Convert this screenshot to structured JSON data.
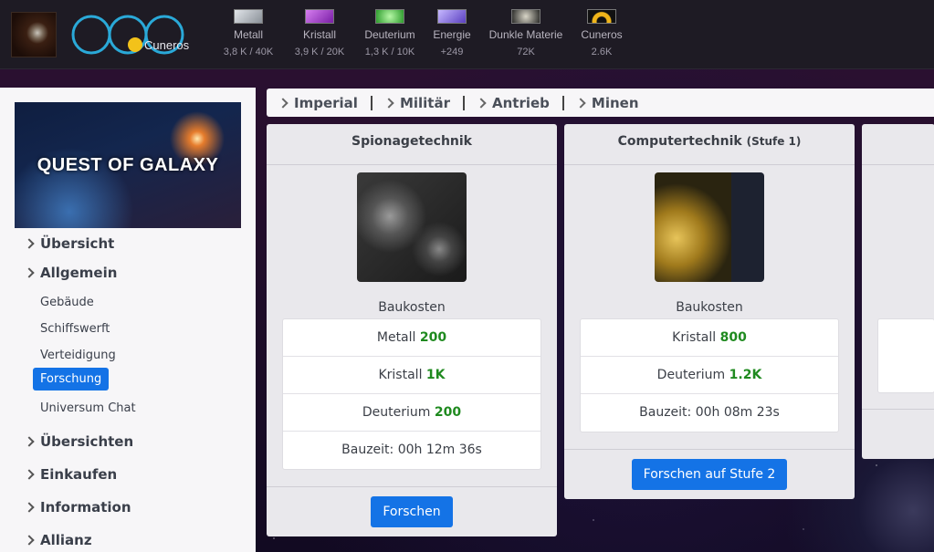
{
  "resources": [
    {
      "name": "Metall",
      "value": "3,8 K / 40K",
      "icon": "metal-icon",
      "color": "#b8bec6"
    },
    {
      "name": "Kristall",
      "value": "3,9 K / 20K",
      "icon": "crystal-icon",
      "color": "#b44ad8"
    },
    {
      "name": "Deuterium",
      "value": "1,3 K / 10K",
      "icon": "deuterium-icon",
      "color": "#3ecf3e"
    },
    {
      "name": "Energie",
      "value": "+249",
      "icon": "energy-icon",
      "color": "#7e62d6"
    },
    {
      "name": "Dunkle Materie",
      "value": "72K",
      "icon": "dark-matter-icon",
      "color": "#8a8a82"
    },
    {
      "name": "Cuneros",
      "value": "2.6K",
      "icon": "cuneros-icon",
      "color": "#f0b51a"
    }
  ],
  "logo": {
    "text": "Cuneros"
  },
  "sidebar": {
    "banner_title": "QUEST OF GALAXY",
    "sections": [
      {
        "label": "Übersicht"
      },
      {
        "label": "Allgemein"
      },
      {
        "label": "Übersichten"
      },
      {
        "label": "Einkaufen"
      },
      {
        "label": "Information"
      },
      {
        "label": "Allianz"
      }
    ],
    "sub_items": [
      {
        "label": "Gebäude"
      },
      {
        "label": "Schiffswerft"
      },
      {
        "label": "Verteidigung"
      },
      {
        "label": "Forschung",
        "active": true
      },
      {
        "label": "Universum Chat"
      }
    ]
  },
  "tabs": [
    {
      "label": "Imperial"
    },
    {
      "label": "Militär"
    },
    {
      "label": "Antrieb"
    },
    {
      "label": "Minen"
    }
  ],
  "cards": [
    {
      "title": "Spionagetechnik",
      "level": "",
      "cost_label": "Baukosten",
      "costs": [
        {
          "name": "Metall",
          "amount": "200"
        },
        {
          "name": "Kristall",
          "amount": "1K"
        },
        {
          "name": "Deuterium",
          "amount": "200"
        }
      ],
      "time": "Bauzeit: 00h 12m 36s",
      "button": "Forschen"
    },
    {
      "title": "Computertechnik",
      "level": "(Stufe 1)",
      "cost_label": "Baukosten",
      "costs": [
        {
          "name": "Kristall",
          "amount": "800"
        },
        {
          "name": "Deuterium",
          "amount": "1.2K"
        }
      ],
      "time": "Bauzeit: 00h 08m 23s",
      "button": "Forschen auf Stufe 2"
    }
  ],
  "accent_color": "#1473e6",
  "amount_color": "#1f8a1f"
}
